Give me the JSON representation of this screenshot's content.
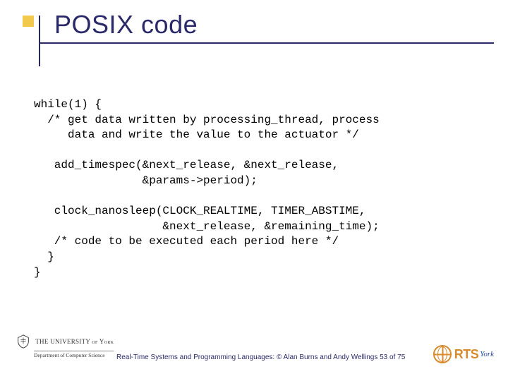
{
  "title": "POSIX code",
  "code": "while(1) {\n  /* get data written by processing_thread, process\n     data and write the value to the actuator */\n\n   add_timespec(&next_release, &next_release,\n                &params->period);\n\n   clock_nanosleep(CLOCK_REALTIME, TIMER_ABSTIME,\n                   &next_release, &remaining_time);\n   /* code to be executed each period here */\n  }\n}",
  "footer": {
    "university_line": "THE UNIVERSITY of York",
    "department": "Department of Computer Science",
    "credit": "Real-Time Systems and Programming Languages: © Alan Burns and Andy Wellings 53 of 75",
    "rts": "RTS",
    "rts_sub": "York"
  }
}
